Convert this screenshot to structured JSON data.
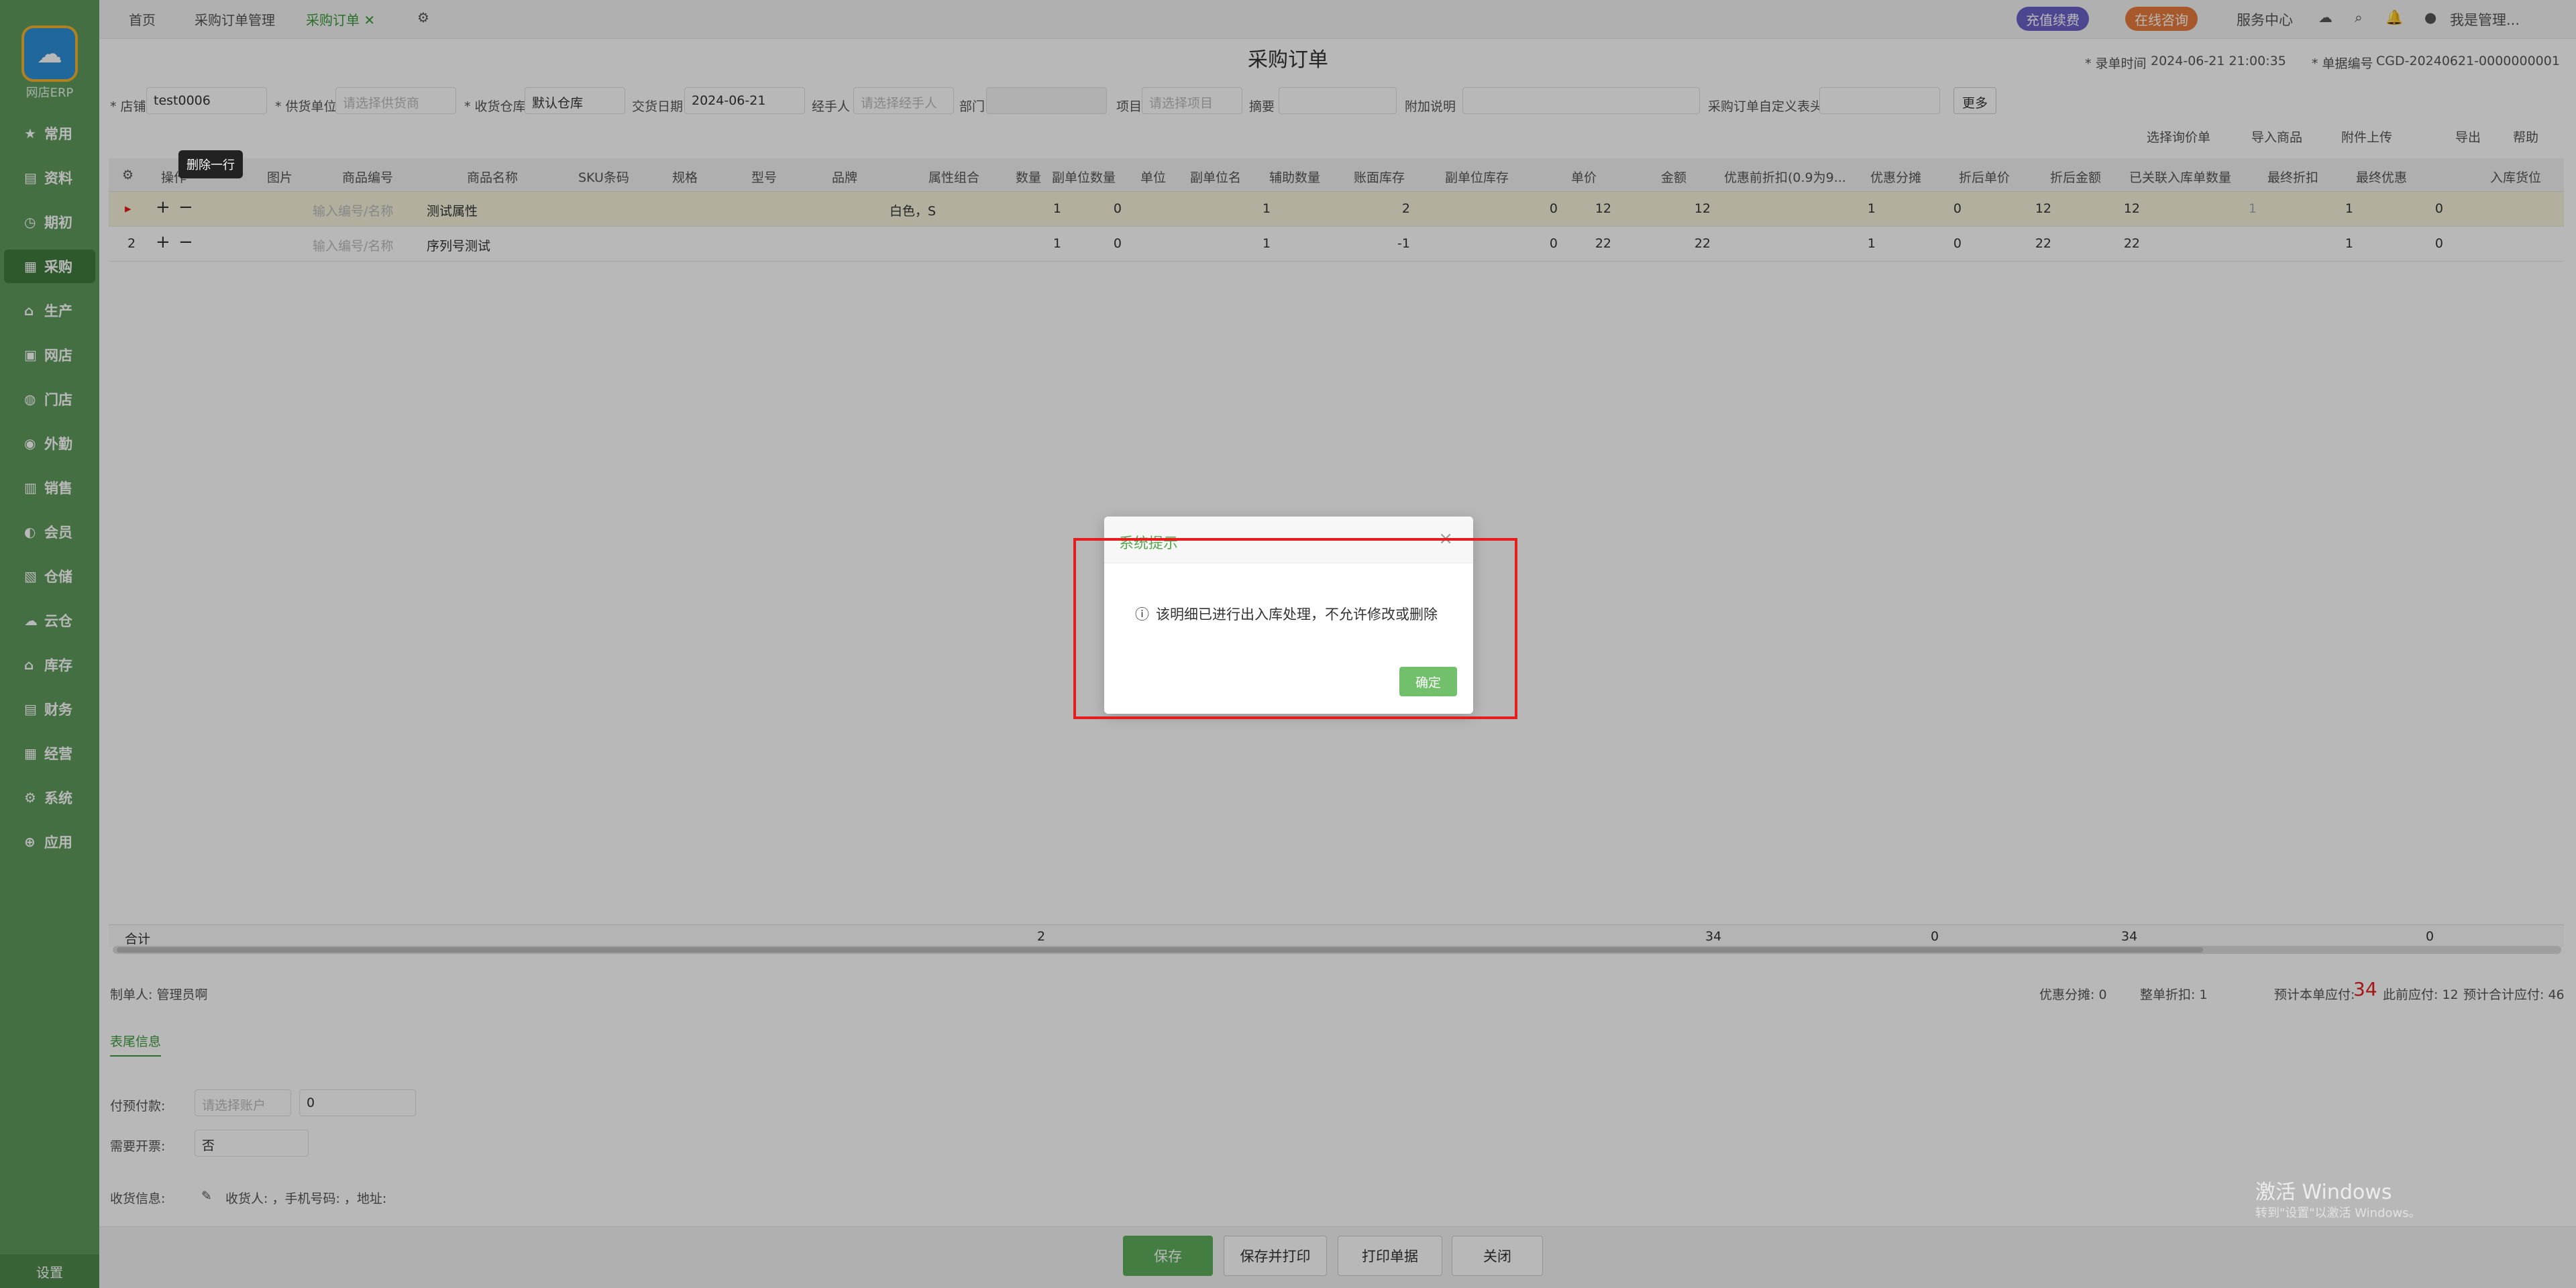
{
  "app": {
    "logo_text": "网店ERP"
  },
  "sidebar": {
    "items": [
      {
        "label": "常用",
        "icon": "star-icon"
      },
      {
        "label": "资料",
        "icon": "book-icon"
      },
      {
        "label": "期初",
        "icon": "clock-icon"
      },
      {
        "label": "采购",
        "icon": "cart-icon",
        "active": true
      },
      {
        "label": "生产",
        "icon": "factory-icon"
      },
      {
        "label": "网店",
        "icon": "shop-icon"
      },
      {
        "label": "门店",
        "icon": "store-icon"
      },
      {
        "label": "外勤",
        "icon": "location-icon"
      },
      {
        "label": "销售",
        "icon": "sales-icon"
      },
      {
        "label": "会员",
        "icon": "member-icon"
      },
      {
        "label": "仓储",
        "icon": "warehouse-icon"
      },
      {
        "label": "云仓",
        "icon": "cloud-icon"
      },
      {
        "label": "库存",
        "icon": "inventory-icon"
      },
      {
        "label": "财务",
        "icon": "finance-icon"
      },
      {
        "label": "经营",
        "icon": "business-icon"
      },
      {
        "label": "系统",
        "icon": "system-icon"
      },
      {
        "label": "应用",
        "icon": "app-icon"
      }
    ],
    "settings_label": "设置"
  },
  "tabs": [
    {
      "label": "首页"
    },
    {
      "label": "采购订单管理"
    },
    {
      "label": "采购订单",
      "active": true
    }
  ],
  "topbar": {
    "recharge_label": "充值续费",
    "consult_label": "在线咨询",
    "service_label": "服务中心",
    "user_label": "我是管理..."
  },
  "page": {
    "title": "采购订单",
    "record_time_label": "* 录单时间",
    "record_time": "2024-06-21 21:00:35",
    "order_no_label": "* 单据编号",
    "order_no": "CGD-20240621-0000000001"
  },
  "form": {
    "shop_label": "* 店铺",
    "shop_value": "test0006",
    "supplier_label": "* 供货单位",
    "supplier_placeholder": "请选择供货商",
    "warehouse_label": "* 收货仓库",
    "warehouse_value": "默认仓库",
    "date_label": "交货日期",
    "date_value": "2024-06-21",
    "handler_label": "经手人",
    "handler_placeholder": "请选择经手人",
    "dept_label": "部门",
    "project_label": "项目",
    "project_placeholder": "请选择项目",
    "summary_label": "摘要",
    "note_label": "附加说明",
    "custom_label": "采购订单自定义表头",
    "more_label": "更多"
  },
  "toolbar": {
    "choose_price": "选择询价单",
    "import_goods": "导入商品",
    "upload_attach": "附件上传",
    "export": "导出",
    "help": "帮助"
  },
  "table": {
    "headers": [
      "操作",
      "图片",
      "商品编号",
      "商品名称",
      "SKU条码",
      "规格",
      "型号",
      "品牌",
      "属性组合",
      "数量",
      "副单位数量",
      "单位",
      "副单位名",
      "辅助数量",
      "账面库存",
      "副单位库存",
      "单价",
      "金额",
      "优惠前折扣(0.9为9...",
      "优惠分摊",
      "折后单价",
      "折后金额",
      "已关联入库单数量",
      "最终折扣",
      "最终优惠",
      "入库货位"
    ],
    "code_placeholder": "输入编号/名称",
    "rows": [
      {
        "idx": "",
        "name": "测试属性",
        "attr": "白色，S",
        "qty": "1",
        "sub_qty": "0",
        "aux_qty": "1",
        "stock": "2",
        "sub_stock": "0",
        "price": "12",
        "amount": "12",
        "pre_disc": "1",
        "share": "0",
        "disc_price": "12",
        "disc_amount": "12",
        "linked": "1",
        "final_disc": "1",
        "final_off": "0"
      },
      {
        "idx": "2",
        "name": "序列号测试",
        "attr": "",
        "qty": "1",
        "sub_qty": "0",
        "aux_qty": "1",
        "stock": "-1",
        "sub_stock": "0",
        "price": "22",
        "amount": "22",
        "pre_disc": "1",
        "share": "0",
        "disc_price": "22",
        "disc_amount": "22",
        "linked": "",
        "final_disc": "1",
        "final_off": "0"
      }
    ],
    "sum": {
      "label": "合计",
      "qty": "2",
      "amount": "34",
      "share": "0",
      "disc_amount": "34",
      "final_off": "0"
    }
  },
  "footer": {
    "maker_label": "制单人: 管理员啊",
    "discount_share": "优惠分摊:  0",
    "whole_discount": "整单折扣:  1",
    "est_label": "预计本单应付:",
    "est_value": "34",
    "prev_payable": "此前应付: 12",
    "total_payable": "预计合计应付: 46",
    "subtab": "表尾信息",
    "prepay_label": "付预付款:",
    "prepay_account_placeholder": "请选择账户",
    "prepay_amount": "0",
    "invoice_label": "需要开票:",
    "invoice_value": "否",
    "receive_label": "收货信息:",
    "receive_value": "收货人: ，手机号码: ，地址:"
  },
  "actions": {
    "save": "保存",
    "save_print": "保存并打印",
    "print": "打印单据",
    "close": "关闭"
  },
  "tooltip": {
    "text": "删除一行"
  },
  "dialog": {
    "title": "系统提示",
    "message": "该明细已进行出入库处理，不允许修改或删除",
    "ok": "确定"
  },
  "watermark": {
    "line1": "激活 Windows",
    "line2": "转到\"设置\"以激活 Windows。"
  }
}
